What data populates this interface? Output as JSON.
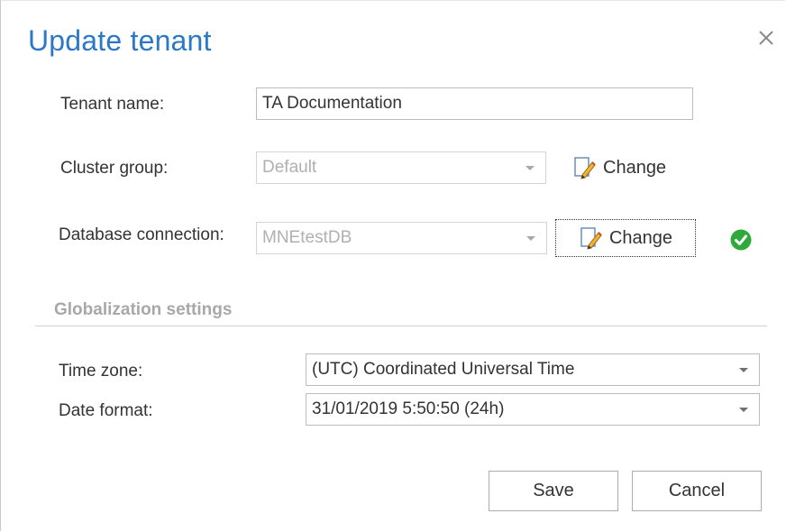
{
  "dialog": {
    "title": "Update tenant",
    "close_icon": "close-icon"
  },
  "form": {
    "tenant_name": {
      "label": "Tenant name:",
      "value": "TA Documentation"
    },
    "cluster_group": {
      "label": "Cluster group:",
      "value": "Default",
      "disabled": true,
      "change_label": "Change",
      "change_icon": "edit-document-icon"
    },
    "database_connection": {
      "label": "Database connection:",
      "value": "MNEtestDB",
      "disabled": true,
      "change_label": "Change",
      "change_icon": "edit-document-icon",
      "status_icon": "check-circle-icon"
    }
  },
  "globalization": {
    "section_title": "Globalization settings",
    "time_zone": {
      "label": "Time zone:",
      "value": "(UTC) Coordinated Universal Time"
    },
    "date_format": {
      "label": "Date format:",
      "value": "31/01/2019 5:50:50 (24h)"
    }
  },
  "actions": {
    "save_label": "Save",
    "cancel_label": "Cancel"
  },
  "colors": {
    "title": "#2a78c6",
    "success": "#2eaa3a",
    "section_title": "#a8a8a8"
  }
}
